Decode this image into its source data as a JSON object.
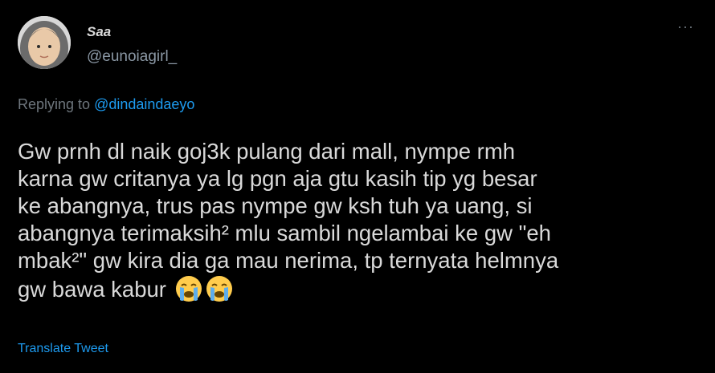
{
  "user": {
    "display_name": "Saa",
    "handle": "@eunoiagirl_",
    "avatar_icon": "profile-photo"
  },
  "more_label": "···",
  "reply": {
    "prefix": "Replying to ",
    "mention": "@dindaindaeyo"
  },
  "tweet": {
    "text": "Gw prnh dl naik goj3k pulang dari mall, nympe rmh\nkarna gw critanya ya lg pgn aja gtu kasih tip yg besar\nke abangnya, trus pas nympe gw ksh tuh ya uang, si\nabangnya terimaksih² mlu sambil ngelambai ke gw \"eh\nmbak²\" gw kira dia ga mau nerima, tp ternyata helmnya\ngw bawa kabur",
    "emojis": [
      "loudly-crying-face",
      "loudly-crying-face"
    ]
  },
  "translate_label": "Translate Tweet",
  "colors": {
    "background": "#000000",
    "text": "#d9d9d9",
    "secondary": "#6e767d",
    "link": "#1d9bf0"
  }
}
